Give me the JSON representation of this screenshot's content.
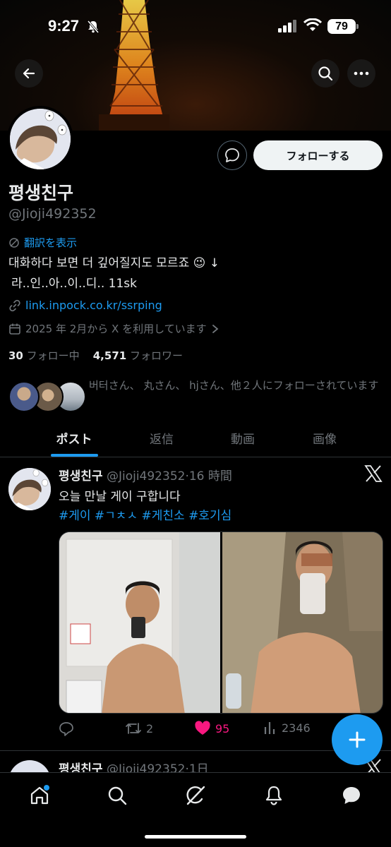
{
  "status_bar": {
    "time": "9:27",
    "battery": "79"
  },
  "profile": {
    "name": "평생친구",
    "handle": "@Jioji492352",
    "translate_label": "翻訳を表示",
    "bio_line1": "대화하다 보면 더 깊어질지도 모르죠 😉 ↓",
    "bio_line2": "라..인..아..이..디.. 11sk",
    "link": "link.inpock.co.kr/ssrping",
    "joined": "2025 年 2月から X を利用しています",
    "following_count": "30",
    "following_label": "フォロー中",
    "followers_count": "4,571",
    "followers_label": "フォロワー",
    "followed_by_text": "버터さん、 丸さん、 hjさん、他２人にフォローされています",
    "follow_button": "フォローする"
  },
  "tabs": [
    {
      "label": "ポスト",
      "active": true
    },
    {
      "label": "返信",
      "active": false
    },
    {
      "label": "動画",
      "active": false
    },
    {
      "label": "画像",
      "active": false
    }
  ],
  "tweet": {
    "name": "평생친구",
    "handle": "@Jioji492352",
    "sep": "·",
    "time": "16 時間",
    "text": "오늘 만날 게이 구합니다",
    "hashtags": "#게이 #ㄱㅊㅅ #게친소 #호기심",
    "retweets": "2",
    "likes": "95",
    "views": "2346"
  },
  "tweet2": {
    "name": "평생친구",
    "handle": "@Jioji492352",
    "sep": "·",
    "time": "1日"
  },
  "colors": {
    "accent": "#1d9bf0",
    "like": "#f91880",
    "muted": "#71767b",
    "text": "#e7e9ea",
    "divider": "#2f3336"
  },
  "icons": [
    "back-arrow-icon",
    "search-icon",
    "more-icon",
    "message-icon",
    "translate-icon",
    "link-icon",
    "calendar-icon",
    "chevron-right-icon",
    "x-logo-icon",
    "reply-icon",
    "retweet-icon",
    "heart-icon",
    "views-icon",
    "plus-icon",
    "home-icon",
    "grok-icon",
    "bell-icon",
    "chat-icon"
  ]
}
